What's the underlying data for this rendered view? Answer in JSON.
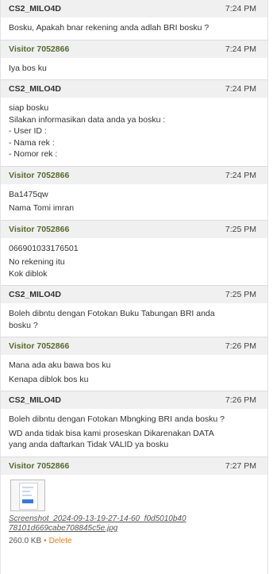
{
  "messages": [
    {
      "sender": "CS2_MILO4D",
      "role": "agent",
      "time": "7:24 PM",
      "paras": [
        [
          "Bosku, Apakah bnar rekening anda adlah BRI bosku ?"
        ]
      ]
    },
    {
      "sender": "Visitor 7052866",
      "role": "visitor",
      "time": "7:24 PM",
      "paras": [
        [
          "Iya bos ku"
        ]
      ]
    },
    {
      "sender": "CS2_MILO4D",
      "role": "agent",
      "time": "7:24 PM",
      "paras": [
        [
          "siap bosku",
          "Silakan informasikan data anda ya bosku :",
          "- User ID :",
          "- Nama rek :",
          "- Nomor rek :"
        ]
      ]
    },
    {
      "sender": "Visitor 7052866",
      "role": "visitor",
      "time": "7:24 PM",
      "paras": [
        [
          "Ba1475qw"
        ],
        [
          "Nama Tomi imran"
        ]
      ]
    },
    {
      "sender": "Visitor 7052866",
      "role": "visitor",
      "time": "7:25 PM",
      "paras": [
        [
          "066901033176501"
        ],
        [
          "No rekening itu",
          "Kok diblok"
        ]
      ]
    },
    {
      "sender": "CS2_MILO4D",
      "role": "agent",
      "time": "7:25 PM",
      "paras": [
        [
          "Boleh dibntu dengan Fotokan Buku Tabungan BRI anda",
          "bosku ?"
        ]
      ]
    },
    {
      "sender": "Visitor 7052866",
      "role": "visitor",
      "time": "7:26 PM",
      "paras": [
        [
          "Mana ada aku bawa bos ku"
        ],
        [
          "Kenapa diblok bos ku"
        ]
      ]
    },
    {
      "sender": "CS2_MILO4D",
      "role": "agent",
      "time": "7:26 PM",
      "paras": [
        [
          "Boleh dibntu dengan Fotokan Mbngking BRI anda bosku ?"
        ],
        [
          "WD anda tidak bisa kami proseskan Dikarenakan DATA",
          "yang anda daftarkan Tidak VALID ya bosku"
        ]
      ]
    }
  ],
  "last_message": {
    "sender": "Visitor 7052866",
    "role": "visitor",
    "time": "7:27 PM",
    "attachment": {
      "filename": "Screenshot_2024-09-13-19-27-14-60_f0d5010b4078101d669cabe708845c5e.jpg",
      "size": "260.0 KB",
      "separator": "•",
      "delete_label": "Delete",
      "thumb_icon": "image-thumbnail-icon"
    }
  },
  "colors": {
    "header_bg": "#f0f0f0",
    "visitor_name": "#556b2f",
    "delete_link": "#e67e22"
  }
}
